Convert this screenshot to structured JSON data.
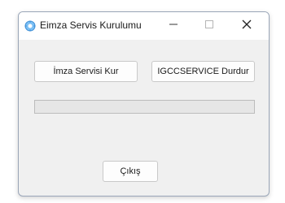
{
  "window": {
    "title": "Eimza Servis Kurulumu",
    "icon": "gear-icon"
  },
  "title_controls": {
    "minimize": "minimize-icon",
    "maximize": "maximize-icon",
    "close": "close-icon"
  },
  "buttons": {
    "install_label": "İmza Servisi Kur",
    "stop_label": "IGCCSERVICE Durdur",
    "exit_label": "Çıkış"
  },
  "progress": {
    "value": 0
  },
  "colors": {
    "accent": "#4aa3f0",
    "window_bg": "#f0f0f0"
  }
}
